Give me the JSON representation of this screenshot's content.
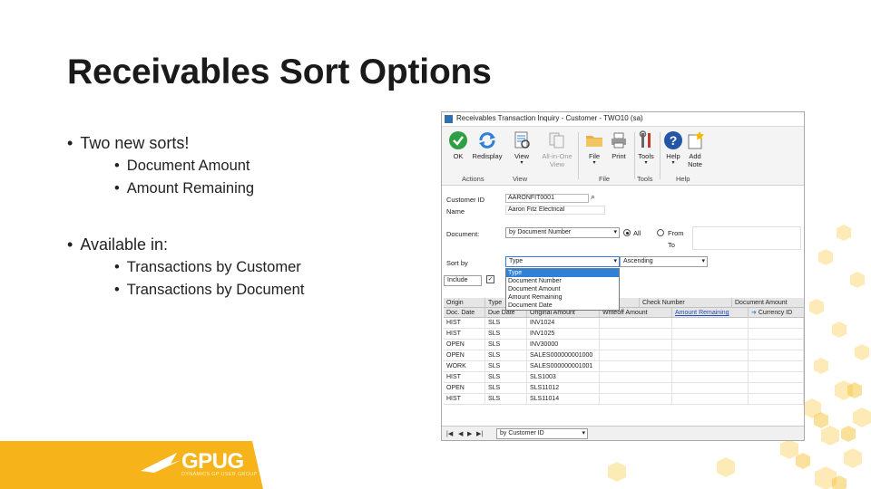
{
  "slide": {
    "title": "Receivables Sort Options",
    "bullets": [
      {
        "text": "Two new sorts!",
        "sub": [
          "Document Amount",
          "Amount Remaining"
        ]
      },
      {
        "text": "Available in:",
        "sub": [
          "Transactions by Customer",
          "Transactions by Document"
        ]
      }
    ],
    "bullet_glyph": "•"
  },
  "logo": {
    "text": "GPUG",
    "subtitle": "DYNAMICS GP USER GROUP"
  },
  "colors": {
    "accent": "#f7b31a",
    "accent_light": "#fde6a4",
    "window_border": "#a9a9a9",
    "link": "#1f4fb8",
    "selection": "#2f80d6"
  },
  "window": {
    "title": "Receivables Transaction Inquiry - Customer - TWO10 (sa)",
    "ribbon": {
      "buttons": [
        {
          "label": "OK",
          "icon": "ok-check-icon"
        },
        {
          "label": "Redisplay",
          "icon": "redisplay-icon"
        },
        {
          "label": "View",
          "icon": "view-icon",
          "has_menu": true
        },
        {
          "label": "All-in-One View",
          "icon": "all-in-one-view-icon"
        },
        {
          "label": "File",
          "icon": "file-icon",
          "has_menu": true
        },
        {
          "label": "Print",
          "icon": "print-icon"
        },
        {
          "label": "Tools",
          "icon": "tools-icon",
          "has_menu": true
        },
        {
          "label": "Help",
          "icon": "help-icon",
          "has_menu": true
        },
        {
          "label": "Add Note",
          "icon": "add-note-icon"
        }
      ],
      "groups": [
        "Actions",
        "View",
        "File",
        "Tools",
        "Help"
      ]
    },
    "form": {
      "customer_id_label": "Customer ID",
      "customer_id_value": "AARONFIT0001",
      "name_label": "Name",
      "name_value": "Aaron Fitz Electrical",
      "document_label": "Document:",
      "document_value": "by Document Number",
      "radio_all": "All",
      "radio_from": "From",
      "to_label": "To",
      "sort_by_label": "Sort by",
      "sort_by_value": "Type",
      "order_value": "Ascending",
      "include_label": "Include"
    },
    "sort_options": [
      "Type",
      "Document Number",
      "Document Amount",
      "Amount Remaining",
      "Document Date"
    ],
    "grid": {
      "header_row1": [
        "Origin",
        "Type",
        "",
        "",
        "Check Number",
        "Document Amount"
      ],
      "header_row2": [
        "Doc. Date",
        "Due Date",
        "Original Amount",
        "Writeoff Amount",
        "Amount Remaining",
        "Currency ID"
      ],
      "rows": [
        [
          "HIST",
          "SLS",
          "INV1024"
        ],
        [
          "HIST",
          "SLS",
          "INV1025"
        ],
        [
          "OPEN",
          "SLS",
          "INV30000"
        ],
        [
          "OPEN",
          "SLS",
          "SALES000000001000"
        ],
        [
          "WORK",
          "SLS",
          "SALES000000001001"
        ],
        [
          "HIST",
          "SLS",
          "SLS1003"
        ],
        [
          "OPEN",
          "SLS",
          "SLS11012"
        ],
        [
          "HIST",
          "SLS",
          "SLS11014"
        ]
      ]
    },
    "statusbar": {
      "sort_value": "by Customer ID",
      "nav": [
        "|◀",
        "◀",
        "▶",
        "▶|"
      ]
    }
  }
}
